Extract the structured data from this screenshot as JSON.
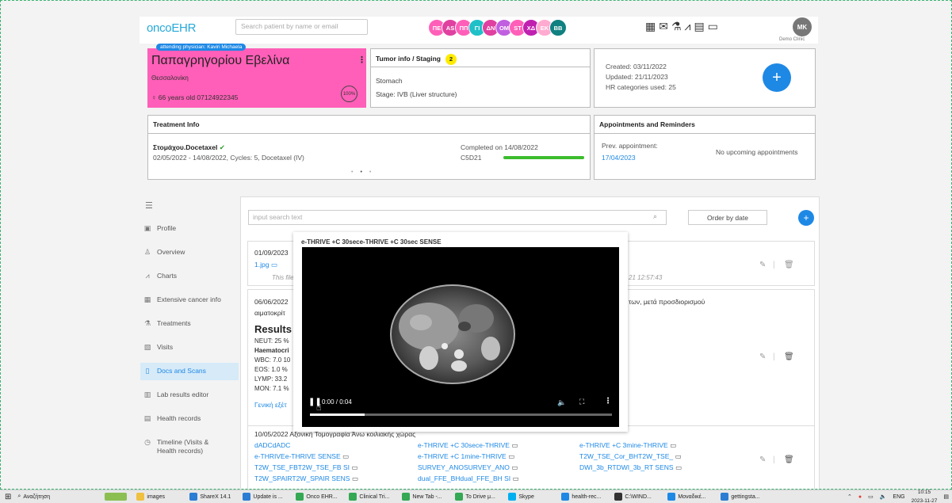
{
  "app": {
    "logo": "oncoEHR",
    "search_placeholder": "Search patient by name or email",
    "avatar": "MK",
    "clinic": "Demo Clinic"
  },
  "chips": [
    {
      "label": "ΠΕ",
      "color": "#ff5fb8"
    },
    {
      "label": "AS",
      "color": "#e040a0"
    },
    {
      "label": "ΠΠ",
      "color": "#ff5fb8"
    },
    {
      "label": "ΓΙ",
      "color": "#20c0c8"
    },
    {
      "label": "ΔΝ",
      "color": "#e040a0"
    },
    {
      "label": "ΟΜ",
      "color": "#c060e0"
    },
    {
      "label": "ST",
      "color": "#ff5fb8"
    },
    {
      "label": "ΧΔ",
      "color": "#c020b0"
    },
    {
      "label": "ΕΚ",
      "color": "#ffaad0"
    },
    {
      "label": "BB",
      "color": "#108080"
    }
  ],
  "top_icons": [
    "calendar-icon",
    "mail-icon",
    "lab-flask-icon",
    "chart-line-icon",
    "calculator-icon",
    "monitor-icon"
  ],
  "patient": {
    "attending": "attending physician: Kaviri Michaela",
    "name": "Παπαγρηγορίου Εβελίνα",
    "city": "Θεσσαλονίκη",
    "info": "♀ 66 years old   07124922345",
    "completion": "100%"
  },
  "tumor": {
    "title": "Tumor info / Staging",
    "count": "2",
    "site": "Stomach",
    "stage": "Stage: IVB (Liver structure)"
  },
  "record": {
    "created": "Created: 03/11/2022",
    "updated": "Updated: 21/11/2023",
    "hr": "HR categories used: 25"
  },
  "treatment": {
    "title": "Treatment Info",
    "regimen": "Στομάχου.Docetaxel",
    "details": "02/05/2022 - 14/08/2022, Cycles: 5, Docetaxel (IV)",
    "completed": "Completed on 14/08/2022",
    "cycle": "C5D21",
    "progress": 1.0
  },
  "appointments": {
    "title": "Appointments and Reminders",
    "prev_label": "Prev. appointment:",
    "prev_date": "17/04/2023",
    "upcoming": "No upcoming appointments"
  },
  "sidebar": [
    {
      "label": "Profile",
      "icon": "profile-card-icon"
    },
    {
      "label": "Overview",
      "icon": "person-icon"
    },
    {
      "label": "Charts",
      "icon": "chart-icon"
    },
    {
      "label": "Extensive cancer info",
      "icon": "info-table-icon"
    },
    {
      "label": "Treatments",
      "icon": "flask-icon"
    },
    {
      "label": "Visits",
      "icon": "visits-icon"
    },
    {
      "label": "Docs and Scans",
      "icon": "document-icon"
    },
    {
      "label": "Lab results editor",
      "icon": "grid-icon"
    },
    {
      "label": "Health records",
      "icon": "records-icon"
    },
    {
      "label": "Timeline (Visits & Health records)",
      "icon": "timeline-icon"
    }
  ],
  "docs": {
    "search_placeholder": "input search text",
    "order": "Order by date",
    "doc1": {
      "date": "01/09/2023",
      "file": "1.jpg",
      "note": "This file",
      "timestamp": "21 12:57:43"
    },
    "doc2": {
      "date": "06/06/2022",
      "subtitle": "αιματοκρίτ",
      "right_text": "των, μετά προσδιορισμού",
      "results_title": "Results",
      "results": [
        "NEUT: 25 %",
        "Haematocri",
        "WBC: 7.0 10",
        "EOS: 1.0 %",
        "LYMP: 33.2",
        "MON: 7.1 %"
      ],
      "link": "Γενική εξέτ"
    },
    "doc3": {
      "title": "10/05/2022 Αξονική Τομογραφία Άνω κοιλιακής χώρας",
      "col1": [
        "dADCdADC",
        "e-THRIVEe-THRIVE SENSE",
        "T2W_TSE_FBT2W_TSE_FB SI",
        "T2W_SPAIRT2W_SPAIR SENS"
      ],
      "col2": [
        "e-THRIVE +C 30sece-THRIVE",
        "e-THRIVE +C 1mine-THRIVE",
        "SURVEY_ANOSURVEY_ANO",
        "dual_FFE_BHdual_FFE_BH SI"
      ],
      "col3": [
        "e-THRIVE +C 3mine-THRIVE",
        "T2W_TSE_Cor_BHT2W_TSE_",
        "DWI_3b_RTDWI_3b_RT SENS"
      ]
    }
  },
  "video": {
    "title": "e-THRIVE +C 30sece-THRIVE +C 30sec SENSE",
    "time": "0:00 / 0:04",
    "progress": 0.18
  },
  "taskbar": {
    "search": "Αναζήτηση",
    "items": [
      "images",
      "ShareX 14.1",
      "Update is ...",
      "Onco EHR...",
      "Clinical Tri...",
      "New Tab -...",
      "To Drive μ...",
      "Skype",
      "health-rec...",
      "C:\\WIND...",
      "Μοναδικέ...",
      "gettingsta..."
    ],
    "lang": "ENG",
    "time": "10:15",
    "date": "2023-11-27"
  }
}
